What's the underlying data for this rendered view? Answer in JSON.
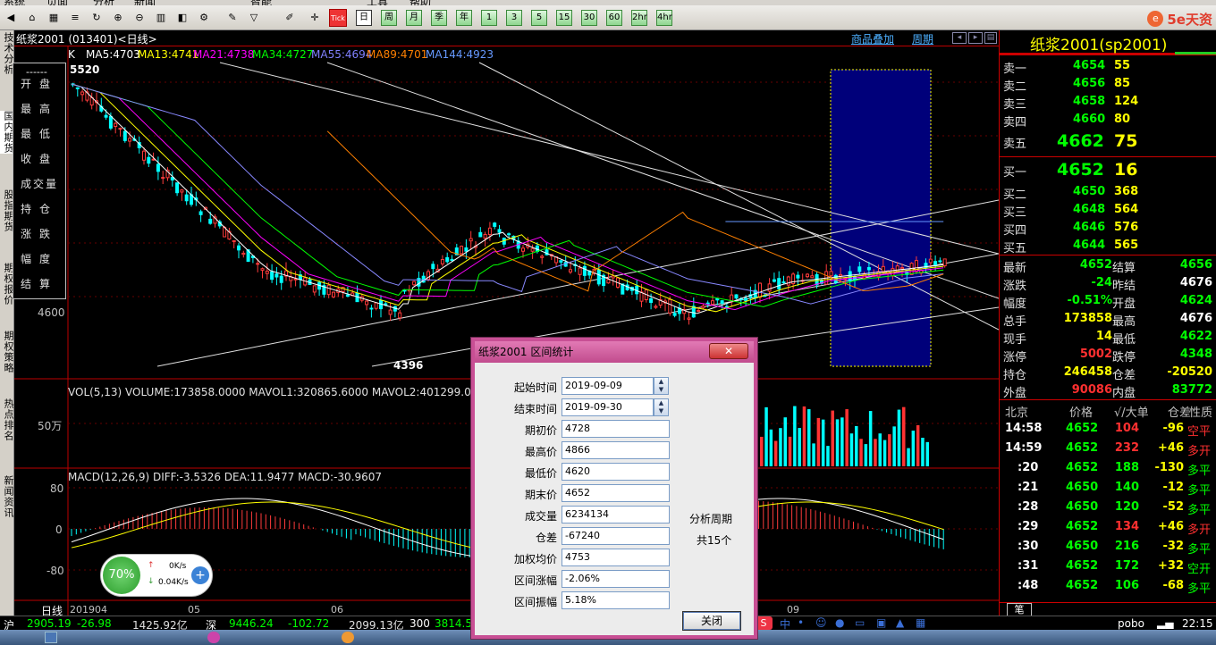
{
  "menu": [
    "系统",
    "页面",
    "分析",
    "新闻",
    "智能",
    "工具",
    "帮助"
  ],
  "toolbar": {
    "period_buttons": [
      "日",
      "周",
      "月",
      "季",
      "年",
      "1",
      "3",
      "5",
      "15",
      "30",
      "60",
      "2hr",
      "4hr"
    ],
    "tick_label": "Tick",
    "brand": "5e天资"
  },
  "left_tabs": [
    "技术分析",
    "国内期货",
    "股指期货",
    "期权报价",
    "期权策略",
    "热点排名",
    "新闻资讯"
  ],
  "chart": {
    "title": "纸浆2001 (013401)<日线>",
    "header_links": [
      "商品叠加",
      "周期"
    ],
    "ma_label": "K",
    "ma": [
      {
        "text": "MA5:4703",
        "color": "#ffffff"
      },
      {
        "text": "MA13:4741",
        "color": "#ffff00"
      },
      {
        "text": "MA21:4738",
        "color": "#ff00ff"
      },
      {
        "text": "MA34:4727",
        "color": "#00ff00"
      },
      {
        "text": "MA55:4694",
        "color": "#8080ff"
      },
      {
        "text": "MA89:4701",
        "color": "#ff8000"
      },
      {
        "text": "MA144:4923",
        "color": "#6699ff"
      }
    ],
    "price_high": "5520",
    "price_low": "4396",
    "y_label_4600": "4600",
    "vol_header": "VOL(5,13) VOLUME:173858.0000 MAVOL1:320865.6000 MAVOL2:401299.0769",
    "vol_y": "50万",
    "macd_header": "MACD(12,26,9) DIFF:-3.5326 DEA:11.9477 MACD:-30.9607",
    "macd_y": [
      "80",
      "0",
      "-80"
    ],
    "x_labels": [
      "日线",
      "201904",
      "05",
      "06",
      "09"
    ],
    "info_box": [
      "开盘",
      "最高",
      "最低",
      "收盘",
      "成交量",
      "持仓",
      "涨跌",
      "幅度",
      "结算"
    ]
  },
  "quote": {
    "title": "纸浆2001(sp2001)",
    "asks": [
      {
        "label": "卖五",
        "price": "4662",
        "vol": "75"
      },
      {
        "label": "卖四",
        "price": "4660",
        "vol": "80"
      },
      {
        "label": "卖三",
        "price": "4658",
        "vol": "124"
      },
      {
        "label": "卖二",
        "price": "4656",
        "vol": "85"
      },
      {
        "label": "卖一",
        "price": "4654",
        "vol": "55"
      }
    ],
    "bids": [
      {
        "label": "买一",
        "price": "4652",
        "vol": "16"
      },
      {
        "label": "买二",
        "price": "4650",
        "vol": "368"
      },
      {
        "label": "买三",
        "price": "4648",
        "vol": "564"
      },
      {
        "label": "买四",
        "price": "4646",
        "vol": "576"
      },
      {
        "label": "买五",
        "price": "4644",
        "vol": "565"
      }
    ],
    "stats": [
      {
        "l1": "最新",
        "v1": "4652",
        "c1": "#00ff00",
        "l2": "结算",
        "v2": "4656",
        "c2": "#00ff00"
      },
      {
        "l1": "涨跌",
        "v1": "-24",
        "c1": "#00ff00",
        "l2": "昨结",
        "v2": "4676",
        "c2": "#ffffff"
      },
      {
        "l1": "幅度",
        "v1": "-0.51%",
        "c1": "#00ff00",
        "l2": "开盘",
        "v2": "4624",
        "c2": "#00ff00"
      },
      {
        "l1": "总手",
        "v1": "173858",
        "c1": "#ffff00",
        "l2": "最高",
        "v2": "4676",
        "c2": "#ffffff"
      },
      {
        "l1": "现手",
        "v1": "14",
        "c1": "#ffff00",
        "l2": "最低",
        "v2": "4622",
        "c2": "#00ff00"
      },
      {
        "l1": "涨停",
        "v1": "5002",
        "c1": "#ff3030",
        "l2": "跌停",
        "v2": "4348",
        "c2": "#00ff00"
      },
      {
        "l1": "持仓",
        "v1": "246458",
        "c1": "#ffff00",
        "l2": "仓差",
        "v2": "-20520",
        "c2": "#ffff00"
      },
      {
        "l1": "外盘",
        "v1": "90086",
        "c1": "#ff3030",
        "l2": "内盘",
        "v2": "83772",
        "c2": "#00ff00"
      }
    ],
    "ticks_header": [
      "北京",
      "价格",
      "√/大单",
      "仓差",
      "性质"
    ],
    "ticks": [
      {
        "t": "14:58",
        "p": "4652",
        "v": "104",
        "vc": "#ff3030",
        "d": "-96",
        "dc": "#ffff00",
        "n": "空平",
        "nc": "#ff3030"
      },
      {
        "t": "14:59",
        "p": "4652",
        "v": "232",
        "vc": "#ff3030",
        "d": "+46",
        "dc": "#ffff00",
        "n": "多开",
        "nc": "#ff3030"
      },
      {
        "t": ":20",
        "p": "4652",
        "v": "188",
        "vc": "#00ff00",
        "d": "-130",
        "dc": "#ffff00",
        "n": "多平",
        "nc": "#00ff00"
      },
      {
        "t": ":21",
        "p": "4650",
        "v": "140",
        "vc": "#00ff00",
        "d": "-12",
        "dc": "#ffff00",
        "n": "多平",
        "nc": "#00ff00"
      },
      {
        "t": ":28",
        "p": "4650",
        "v": "120",
        "vc": "#00ff00",
        "d": "-52",
        "dc": "#ffff00",
        "n": "多平",
        "nc": "#00ff00"
      },
      {
        "t": ":29",
        "p": "4652",
        "v": "134",
        "vc": "#ff3030",
        "d": "+46",
        "dc": "#ffff00",
        "n": "多开",
        "nc": "#ff3030"
      },
      {
        "t": ":30",
        "p": "4650",
        "v": "216",
        "vc": "#00ff00",
        "d": "-32",
        "dc": "#ffff00",
        "n": "多平",
        "nc": "#00ff00"
      },
      {
        "t": ":31",
        "p": "4652",
        "v": "172",
        "vc": "#00ff00",
        "d": "+32",
        "dc": "#ffff00",
        "n": "空开",
        "nc": "#00ff00"
      },
      {
        "t": ":48",
        "p": "4652",
        "v": "106",
        "vc": "#00ff00",
        "d": "-68",
        "dc": "#ffff00",
        "n": "多平",
        "nc": "#00ff00"
      }
    ],
    "footer_tab": "笔"
  },
  "dialog": {
    "title": "纸浆2001 区间统计",
    "close_label": "✕",
    "fields": [
      {
        "label": "起始时间",
        "value": "2019-09-09"
      },
      {
        "label": "结束时间",
        "value": "2019-09-30"
      },
      {
        "label": "期初价",
        "value": "4728"
      },
      {
        "label": "最高价",
        "value": "4866"
      },
      {
        "label": "最低价",
        "value": "4620"
      },
      {
        "label": "期末价",
        "value": "4652"
      },
      {
        "label": "成交量",
        "value": "6234134"
      },
      {
        "label": "仓差",
        "value": "-67240"
      },
      {
        "label": "加权均价",
        "value": "4753"
      },
      {
        "label": "区间涨幅",
        "value": "-2.06%"
      },
      {
        "label": "区间振幅",
        "value": "5.18%"
      }
    ],
    "period_label": "分析周期",
    "period_count": "共15个",
    "ok_label": "关闭"
  },
  "net_widget": {
    "percent": "70%",
    "up": "0K/s",
    "down": "0.04K/s"
  },
  "status": {
    "sh_label": "沪",
    "sh_val": "2905.19",
    "sh_chg": "-26.98",
    "sh_amt": "1425.92亿",
    "sz_label": "深",
    "sz_val": "9446.24",
    "sz_chg": "-102.72",
    "sz_amt": "2099.13亿",
    "i300_label": "300",
    "i300_val": "3814.5",
    "brand": "pobo",
    "clock": "22:15"
  }
}
